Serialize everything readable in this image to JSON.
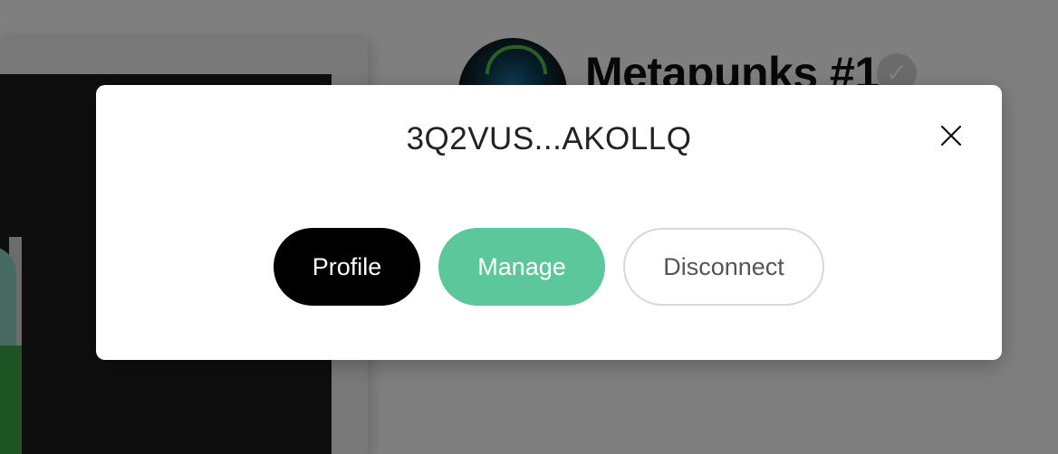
{
  "background": {
    "title": "Metapunks #1",
    "verified_icon": "checkmark-badge-icon",
    "avatar_icon": "nft-avatar"
  },
  "modal": {
    "address": "3Q2VUS...AKOLLQ",
    "close_icon": "close-icon",
    "buttons": {
      "profile": "Profile",
      "manage": "Manage",
      "disconnect": "Disconnect"
    }
  },
  "colors": {
    "overlay": "rgba(0,0,0,0.5)",
    "profile_bg": "#000000",
    "manage_bg": "#5bc79a",
    "disconnect_border": "#d8d8d8"
  }
}
